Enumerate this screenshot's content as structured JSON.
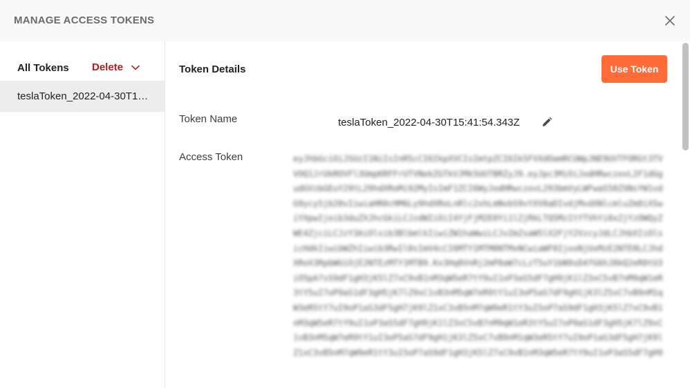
{
  "dialog": {
    "title": "MANAGE ACCESS TOKENS",
    "close_icon": "close-icon"
  },
  "sidebar": {
    "all_tokens_label": "All Tokens",
    "delete_label": "Delete",
    "delete_icon": "chevron-down-icon",
    "tokens": [
      {
        "label": "teslaToken_2022-04-30T15:41:54.343Z"
      }
    ]
  },
  "details": {
    "title": "Token Details",
    "use_token_label": "Use Token",
    "token_name_label": "Token Name",
    "token_name_value": "teslaToken_2022-04-30T15:41:54.343Z",
    "edit_icon": "pencil-icon",
    "access_token_label": "Access Token",
    "access_token_value": "eyJhbGciOiJSUzI1NiIsInR5cCI6IkpXVCIsImtpZCI6Ik5FVXdOamRCUWpJNE9UVTFORGt3TVVOQ1JrUkROVFl3UmpKRFFrUTVNekZGTkVJMk5UUTBRZyJ9.eyJpc3MiOiJodHRwczovL2F1dGgudGVzbGEuY29tL29hdXRoMi92MyIsImF1ZCI6WyJodHRwczovL293bmVyLWFwaS50ZXNsYW1vdG9ycy5jb20vIiwiaHR0cHM6Ly9hdXRoLnRlc2xhLmNvbS9vYXV0aDIvdjMvdXNlcmluZm8iXSwiYXpwIjoib3duZXJhcGkiLCJzdWIiOiI4YjFjM2E0Yi1lZjRkLTQ5MzItYTVhYi0xZjYzOWQyZWE4ZjciLCJzY3AiOlsib3BlbmlkIiwiZW1haWwiLCJvZmZsaW5lX2FjY2VzcyJdLCJhbXIiOlsicHdkIiwibWZhIiwib3RwIl0sImV4cCI6MTY1MTM0NTMxNCwiaWF0IjoxNjUxMzE2NTE0LCJhdXRoX3RpbWUiOjE2NTEzMTY1MTB9.Kx3Hq8VnRj2mP0aW7cLzT5uY1bN9sD4fG6hJ8kQ2eR0tU3iO5pA7sS9dF1gH3jK5lZ7xC9vB1nM3qW5eR7tY9uI1oP3aS5dF7gH9jK1lZ3xC5vB7nM9qW1eR3tY5uI7oP9aS1dF3gH5jK7lZ9xC1vB3nM5qW7eR9tY1uI3oP5aS7dF9gH1jK3lZ5xC7vB9nM1qW3eR5tY7uI9oP1aS3dF5gH7jK9lZ1xC3vB5nM7qW9eR1tY3uI5oP7aS9dF1gH3jK5lZ7xC9vB1nM3qW5eR7tY9uI1oP3aS5dF7gH9jK1lZ3xC5vB7nM9qW1eR3tY5uI7oP9aS1dF3gH5jK7lZ9xC1vB3nM5qW7eR9tY1uI3oP5aS7dF9gH1jK3lZ5xC7vB9nM1qW3eR5tY7uI9oP1aS3dF5gH7jK9lZ1xC3vB5nM7qW9eR1tY3uI5oP7aS9dF1gH3jK5lZ7xC9vB1nM3qW5eR7tY9uI1oP3aS5dF7gH9jK1lZ3xC5vB7nM9qW1eR3tY5uI7oP9aS1dF3gH5jK7lZ9xC1vB3nM5qW7eR9tY1uI3oP5aS7dF9gH1jK3lZ5xC7vB9nM1qW3eR5tY7uI9oP1aS3dF5gH7jK9lZ1xC3vB5nM7qW9eR1tY3uI5oP7aS9dF1gH3jK5lZ7xC9vB1nM3qW5eR7tY9uI1oP3aS5dF7gH9jK1lZ3xC5vB7nM9qW1eR3tY5uI7oP9aS1dF3gH5jK7lZ9xC1vB3nM5qW7eR9tY1uI3oP5aS7dF9gH1jK3lZ5xC7vB9nM1qW3eR5tY7uI9oP1aS3dF5gH7jK9lZ1xC3vB5nM7qW9eR1tY3uI5oP7aS9dF1gH3jK5lZ7xC9vB1nM3qW5eR7tY9uI1oP3aS5dF7gH9jK1lZ3xC5vB7nM9qW1eR3tY5uI7oP9aS1dF3gH5jK7lZ9xC1vB3nM5qW7eR9tY1uI3oP5aS7dF9gH1jK3lZ5xC7vB9nM1qW3eR5tY7uI9oP1aS3dF5gH7jK9lZ1xC3vB5nM7qW9eR1tY3uI5oP7aS9dF1gH3jK5lZ7xC9vB1nM3qW5eR7tY9uI1oP3aS5dF7gH9jK1lZ3xC5vB7nM9qW1eR3tY5uI7oP9aS1dF3gH5jK7lZ9xC1vB3nM5qW7eR9tY1uI3oP5aS7dF9gH1jK3lZ5xC7vB9nM1qW3eR5tY7uI9oP1aS3dF5gH7jK9lZ1xC3vB5nM7qW9eR1tY3uI5oP7aS9dF1gH3jK5lZ7xC9vB1nM3qW5eR7tY9uI1oP3aS5dF7gH9jK1lZ3xC5vB7nM9qW1eR3tY5uI7oP9aS1dF3gH5jK7lZ9xC1vB3nM5qW7eR9tY1uI3oP5aS7dF9gH1jK3lZ5xC7vB9nM1qW3eR5tY7uI9oP1aS3dF5gH7jK9lZ1xC3vB5nM7qW9eR1tY3uI5oP7aS9dF1gH3jK5lZ7xC9vB1nM3qW5eR7tY9uI1oP3aS5dF7gH9jK1lZ3xC5vB7nM9qW1eR3tY5uI7oP9aS1dF3gH5jK7lZ9xC1vB3nM5qW7eR9tY1uI3oP5aS7dF9gH1jK3lZ5xC7vB9nM1qW3eR5tY7uI9oP1aS3dF5gH7jK9lZ1xC3vB5nM7qW9eR1tY3uI5oP7aS9dF1gH3jK5lZ7xC9vB1nM3qW5eR7tY9uI1oP3aS5dF7gH9jK1lZ3xC5vB7nM9qW1eR3tY5uI7oP9aS1dF3gH5jK7lZ9xC1vB3nM5qW7eR9tY1uI3oP5aS7dF9gH1jK3lZ5xC7vB9nM1qW3eR5tY7uI9oP1aS3dF5gH7jK9"
  },
  "colors": {
    "accent": "#ff6c37",
    "danger": "#b51c1c",
    "header_bg": "#f9f9f9",
    "selected_bg": "#ededed"
  }
}
